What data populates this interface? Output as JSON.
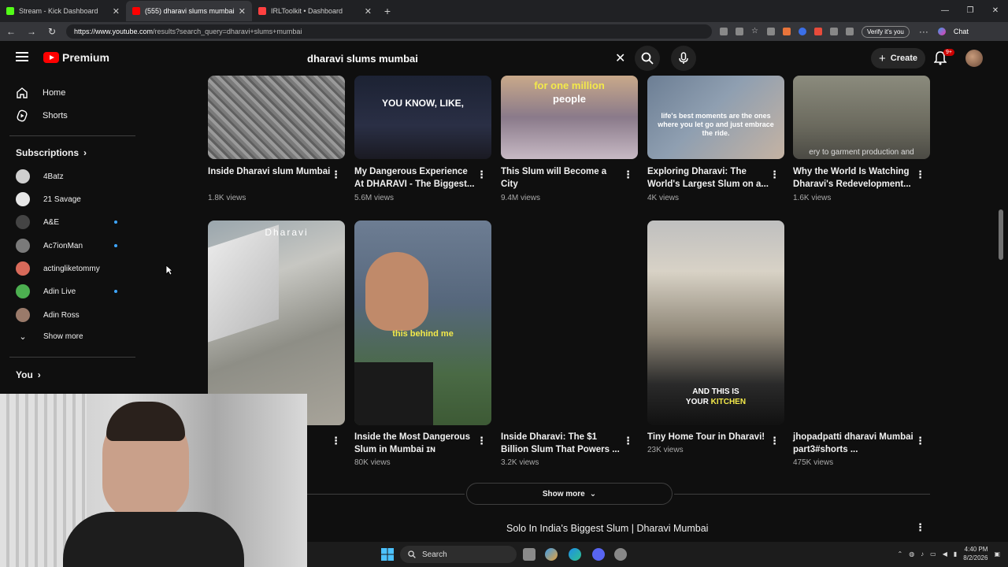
{
  "browser": {
    "tabs": [
      {
        "title": "Stream - Kick Dashboard",
        "color": "#53fc18",
        "active": false
      },
      {
        "title": "(555) dharavi slums mumbai - Yo",
        "color": "#ff0000",
        "active": true
      },
      {
        "title": "IRLToolkit • Dashboard",
        "color": "#ff4040",
        "active": false
      }
    ],
    "url_host": "https://www.youtube.com",
    "url_path": "/results?search_query=dharavi+slums+mumbai",
    "verify_label": "Verify it's you",
    "chat_label": "Chat"
  },
  "youtube": {
    "logo_text": "Premium",
    "search_value": "dharavi slums mumbai",
    "create_label": "Create",
    "notif_badge": "9+"
  },
  "sidebar": {
    "home": "Home",
    "shorts": "Shorts",
    "subscriptions_label": "Subscriptions",
    "subs": [
      {
        "name": "4Batz",
        "color": "#cfcfcf",
        "live": false
      },
      {
        "name": "21 Savage",
        "color": "#e6e6e6",
        "live": false
      },
      {
        "name": "A&E",
        "color": "#444444",
        "live": true
      },
      {
        "name": "Ac7ionMan",
        "color": "#7a7a7a",
        "live": true
      },
      {
        "name": "actingliketommy",
        "color": "#d86a5a",
        "live": false
      },
      {
        "name": "Adin Live",
        "color": "#4caf50",
        "live": true
      },
      {
        "name": "Adin Ross",
        "color": "#9a7a6a",
        "live": false
      }
    ],
    "show_more": "Show more",
    "you_label": "You"
  },
  "videos_row1": [
    {
      "title": "Inside Dharavi slum Mumbai",
      "views": "1.8K views",
      "overlay": ""
    },
    {
      "title": "My Dangerous Experience At DHARAVI - The Biggest...",
      "views": "5.6M views",
      "overlay": "YOU KNOW, LIKE,"
    },
    {
      "title": "This Slum will Become a City",
      "views": "9.4M views",
      "overlay_a": "for one million",
      "overlay_b": "people"
    },
    {
      "title": "Exploring Dharavi: The World's Largest Slum on a...",
      "views": "4K views",
      "overlay": "life's best moments are the ones where you let go and just embrace the ride."
    },
    {
      "title": "Why the World Is Watching Dharavi's Redevelopment...",
      "views": "1.6K views",
      "overlay": "ery to garment production and"
    }
  ],
  "shorts_row": {
    "thumb1_overlay": "Dharavi",
    "thumb2_overlay": "this behind me",
    "thumb4_overlay_a": "AND THIS IS",
    "thumb4_overlay_b": "YOUR",
    "thumb4_overlay_c": "KITCHEN",
    "items": [
      {
        "title": "",
        "views": ""
      },
      {
        "title": "Inside the Most Dangerous Slum in Mumbai ɪɴ",
        "views": "80K views"
      },
      {
        "title": "Inside Dharavi: The $1 Billion Slum That Powers ...",
        "views": "3.2K views"
      },
      {
        "title": "Tiny Home Tour in Dharavi!",
        "views": "23K views"
      },
      {
        "title": "jhopadpatti dharavi Mumbai part3#shorts ...",
        "views": "475K views"
      }
    ]
  },
  "show_more_button": "Show more",
  "next_video_title": "Solo In India's Biggest Slum | Dharavi Mumbai",
  "taskbar": {
    "search_label": "Search",
    "time": "4:40 PM",
    "date": "8/2/2026"
  }
}
